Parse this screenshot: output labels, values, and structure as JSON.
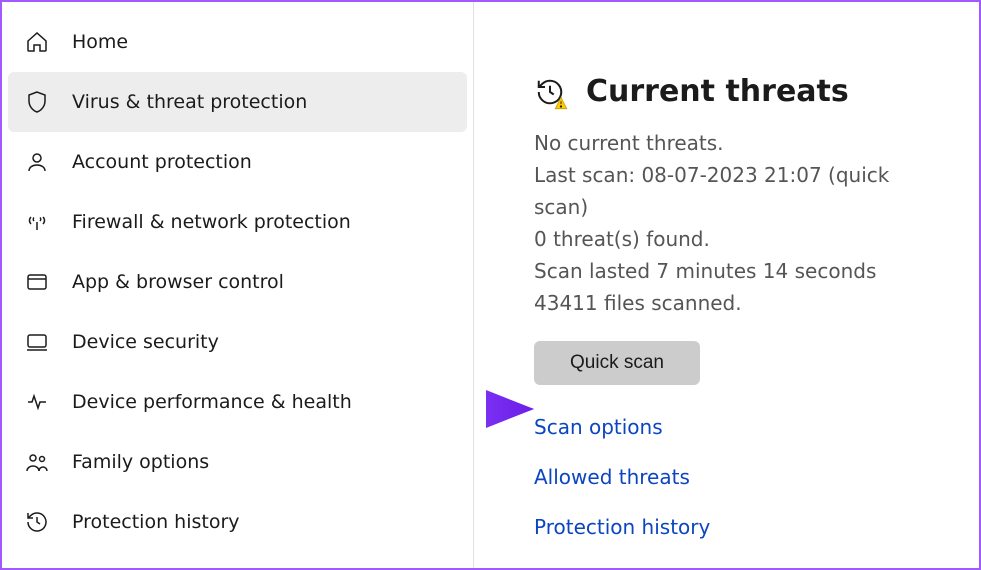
{
  "sidebar": {
    "items": [
      {
        "label": "Home",
        "icon": "home-icon"
      },
      {
        "label": "Virus & threat protection",
        "icon": "shield-icon",
        "selected": true
      },
      {
        "label": "Account protection",
        "icon": "account-icon"
      },
      {
        "label": "Firewall & network protection",
        "icon": "network-icon"
      },
      {
        "label": "App & browser control",
        "icon": "app-browser-icon"
      },
      {
        "label": "Device security",
        "icon": "device-icon"
      },
      {
        "label": "Device performance & health",
        "icon": "health-icon"
      },
      {
        "label": "Family options",
        "icon": "family-icon"
      },
      {
        "label": "Protection history",
        "icon": "history-icon"
      }
    ]
  },
  "main": {
    "section_title": "Current threats",
    "no_threats": "No current threats.",
    "last_scan": "Last scan: 08-07-2023 21:07 (quick scan)",
    "threats_found": "0 threat(s) found.",
    "scan_duration": "Scan lasted 7 minutes 14 seconds",
    "files_scanned": "43411 files scanned.",
    "quick_scan_label": "Quick scan",
    "links": {
      "scan_options": "Scan options",
      "allowed_threats": "Allowed threats",
      "protection_history": "Protection history"
    }
  },
  "annotation": {
    "arrow_target": "scan-options-link",
    "arrow_color": "#7b2ff2"
  }
}
